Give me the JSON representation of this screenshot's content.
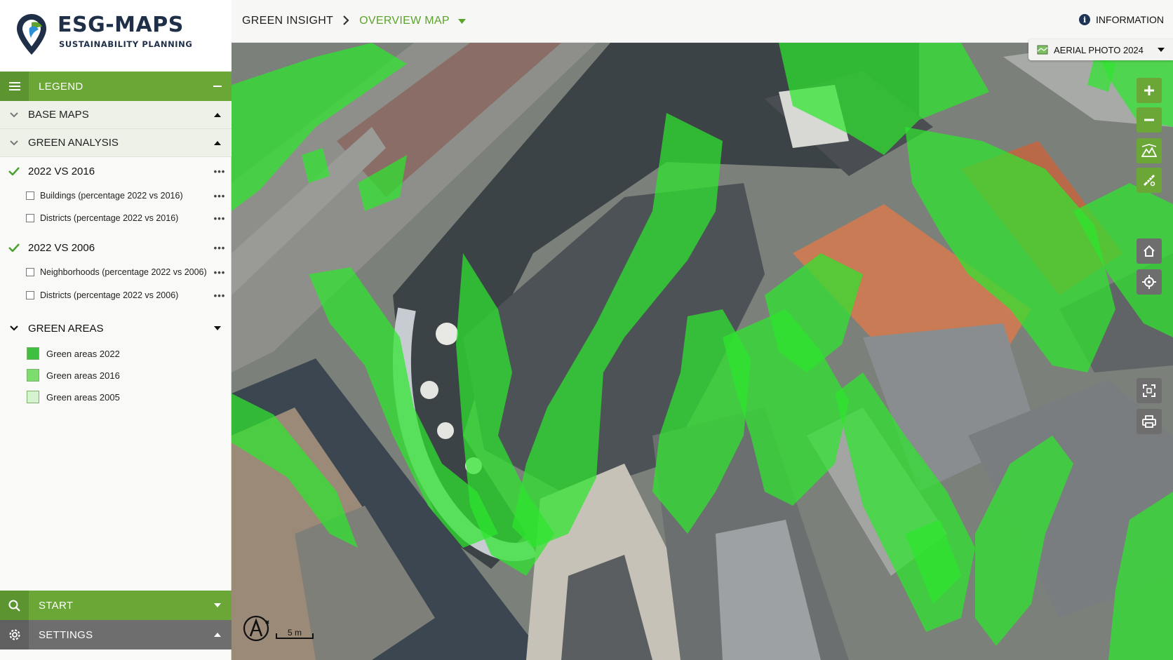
{
  "app": {
    "logo_title": "ESG-MAPS",
    "logo_subtitle": "SUSTAINABILITY PLANNING"
  },
  "header": {
    "breadcrumb_root": "GREEN INSIGHT",
    "breadcrumb_current": "OVERVIEW MAP",
    "info_label": "INFORMATION"
  },
  "sidebar": {
    "legend_label": "LEGEND",
    "sections": {
      "base_maps": "BASE MAPS",
      "green_analysis": "GREEN ANALYSIS"
    },
    "groups": [
      {
        "label": "2022 VS 2016",
        "checked": true,
        "items": [
          {
            "label": "Buildings (percentage 2022 vs 2016)",
            "checked": false
          },
          {
            "label": "Districts (percentage 2022 vs 2016)",
            "checked": false
          }
        ]
      },
      {
        "label": "2022 VS 2006",
        "checked": true,
        "items": [
          {
            "label": "Neighborhoods (percentage 2022 vs 2006)",
            "checked": false
          },
          {
            "label": "Districts (percentage 2022 vs 2006)",
            "checked": false
          }
        ]
      }
    ],
    "green_areas": {
      "label": "GREEN AREAS",
      "entries": [
        {
          "label": "Green areas 2022",
          "color": "#3fbf3f"
        },
        {
          "label": "Green areas 2016",
          "color": "#7ddc6e"
        },
        {
          "label": "Green areas 2005",
          "color": "#d6f3cf"
        }
      ]
    },
    "start_label": "START",
    "settings_label": "SETTINGS"
  },
  "map": {
    "basemap_label": "AERIAL PHOTO 2024",
    "scale_label": "5 m",
    "overlay_color": "#2ee62e"
  },
  "colors": {
    "accent_green": "#6aa736",
    "brand_navy": "#1f2f48",
    "settings_grey": "#6e6e6e"
  }
}
